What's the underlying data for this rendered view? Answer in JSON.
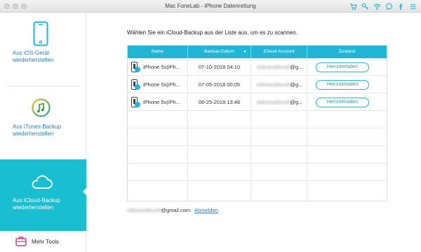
{
  "window": {
    "title": "Mac FoneLab - iPhone Datenrettung"
  },
  "toolbar_icons": [
    "cart-icon",
    "key-icon",
    "wifi-icon",
    "chat-icon",
    "facebook-icon",
    "menu-icon"
  ],
  "sidebar": {
    "items": [
      {
        "label_line1": "Aus iOS-Gerät",
        "label_line2": "wiederherstellen",
        "icon": "phone-icon",
        "active": false
      },
      {
        "label_line1": "Aus iTunes-Backup",
        "label_line2": "wiederherstellen",
        "icon": "itunes-icon",
        "active": false
      },
      {
        "label_line1": "Aus iCloud-Backup",
        "label_line2": "wiederherstellen",
        "icon": "cloud-icon",
        "active": true
      }
    ],
    "more_tools": "Mehr Tools"
  },
  "main": {
    "instruction": "Wählen Sie ein iCloud-Backup aus der Liste aus, um es zu scannen.",
    "columns": [
      "Name",
      "Backup-Datum",
      "iCloud-Account",
      "Zustand"
    ],
    "rows": [
      {
        "name": "iPhone 5s(iPh...",
        "date": "07-10-2018 04:10",
        "account_hidden": "videoaudiosoft",
        "account_suffix": "@g...",
        "action": "Herunterladen"
      },
      {
        "name": "iPhone 5s(iPh...",
        "date": "07-05-2018 00:05",
        "account_hidden": "videoaudiosoft",
        "account_suffix": "@g...",
        "action": "Herunterladen"
      },
      {
        "name": "iPhone 5s(iPh...",
        "date": "06-25-2018 13:48",
        "account_hidden": "videoaudiosoft",
        "account_suffix": "@g...",
        "action": "Herunterladen"
      }
    ],
    "account_hidden": "videoaudiosoft",
    "account_suffix": "@gmail.com",
    "signout": "Abmelden"
  },
  "colors": {
    "accent": "#20b7d6",
    "sidebar_active": "#19bfd0",
    "sidebar_label": "#2a7fb8",
    "link": "#1a7fd0"
  }
}
